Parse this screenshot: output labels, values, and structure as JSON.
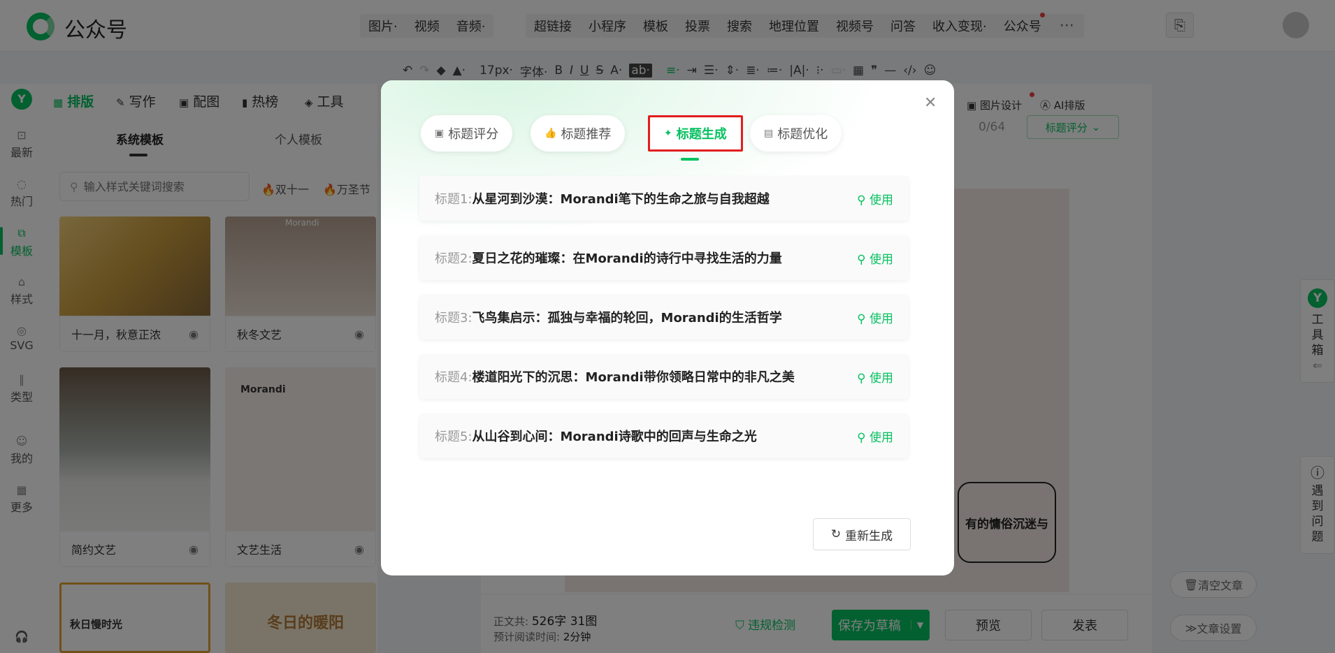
{
  "app": {
    "name": "公众号"
  },
  "topmenu": {
    "group1": [
      "图片·",
      "视频",
      "音频·"
    ],
    "group2": [
      "超链接",
      "小程序",
      "模板",
      "投票",
      "搜索",
      "地理位置",
      "视频号",
      "问答",
      "收入变现·",
      "公众号"
    ],
    "more": "···"
  },
  "toolbar": {
    "font_size": "17px·",
    "font_family": "字体·",
    "bold": "B",
    "italic": "I",
    "underline": "U",
    "strike": "S",
    "color": "A·",
    "bg": "ab·"
  },
  "leftnav": [
    {
      "label": "最新",
      "icon": "new-icon"
    },
    {
      "label": "热门",
      "icon": "fire-icon"
    },
    {
      "label": "模板",
      "icon": "template-icon"
    },
    {
      "label": "样式",
      "icon": "style-icon"
    },
    {
      "label": "SVG",
      "icon": "svg-icon"
    },
    {
      "label": "类型",
      "icon": "type-icon"
    },
    {
      "label": "我的",
      "icon": "user-icon"
    },
    {
      "label": "更多",
      "icon": "grid-icon"
    }
  ],
  "panel": {
    "tabs": [
      "排版",
      "写作",
      "配图",
      "热榜",
      "工具"
    ],
    "subtabs": [
      "系统模板",
      "个人模板"
    ],
    "search_placeholder": "输入样式关键词搜索",
    "tags": [
      "双十一",
      "万圣节"
    ],
    "cards": [
      "十一月，秋意正浓",
      "秋冬文艺",
      "简约文艺",
      "文艺生活"
    ],
    "card_texts": {
      "morandi": "Morandi",
      "autumn": "秋日慢时光",
      "winter": "冬日的暖阳"
    }
  },
  "editor": {
    "counter": "0/64",
    "score_btn": "标题评分",
    "image_design": "图片设计",
    "ai_layout": "AI排版",
    "preview_text": "有的慵俗沉迷与",
    "word_count_label": "正文共:",
    "word_count": "526字 31图",
    "read_time_label": "预计阅读时间:",
    "read_time": "2分钟",
    "check": "违规检测",
    "save": "保存为草稿",
    "preview": "预览",
    "publish": "发表",
    "clear": "清空文章",
    "settings": "文章设置",
    "toolbox": [
      "工",
      "具",
      "箱"
    ],
    "help": [
      "遇",
      "到",
      "问",
      "题"
    ]
  },
  "modal": {
    "tabs": [
      {
        "label": "标题评分",
        "icon": "score-icon"
      },
      {
        "label": "标题推荐",
        "icon": "thumb-icon"
      },
      {
        "label": "标题生成",
        "icon": "magic-wand-icon"
      },
      {
        "label": "标题优化",
        "icon": "optimize-icon"
      }
    ],
    "active_tab": "标题生成",
    "rows": [
      {
        "prefix": "标题1:",
        "title": "从星河到沙漠：Morandi笔下的生命之旅与自我超越",
        "action": "使用"
      },
      {
        "prefix": "标题2:",
        "title": "夏日之花的璀璨：在Morandi的诗行中寻找生活的力量",
        "action": "使用"
      },
      {
        "prefix": "标题3:",
        "title": "飞鸟集启示：孤独与幸福的轮回，Morandi的生活哲学",
        "action": "使用"
      },
      {
        "prefix": "标题4:",
        "title": "楼道阳光下的沉思：Morandi带你领略日常中的非凡之美",
        "action": "使用"
      },
      {
        "prefix": "标题5:",
        "title": "从山谷到心间：Morandi诗歌中的回声与生命之光",
        "action": "使用"
      }
    ],
    "regenerate": "重新生成"
  },
  "colors": {
    "brand": "#07c160",
    "highlight": "#e21d1d"
  }
}
